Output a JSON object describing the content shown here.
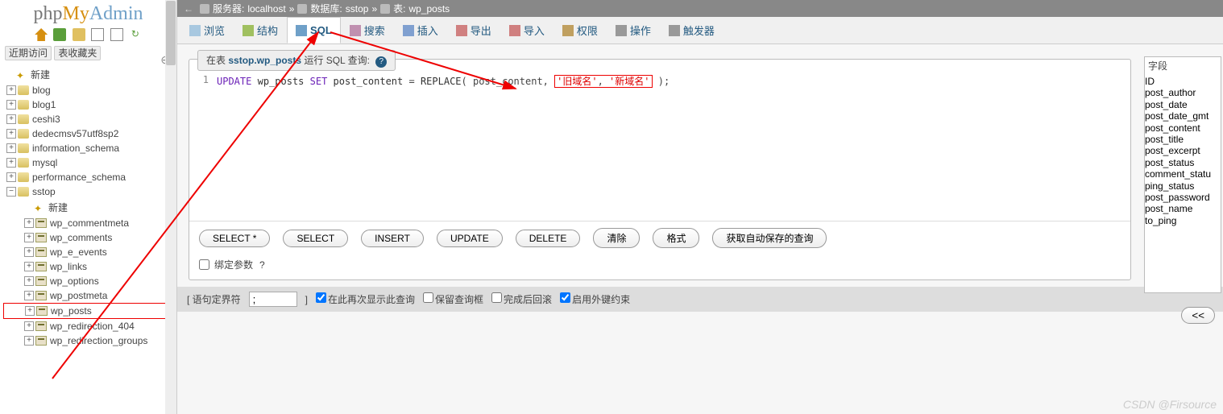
{
  "logo": {
    "part1": "php",
    "part2": "My",
    "part3": "Admin"
  },
  "sidebar_tabs": {
    "recent": "近期访问",
    "fav": "表收藏夹"
  },
  "tree": {
    "new": "新建",
    "dbs": [
      "blog",
      "blog1",
      "ceshi3",
      "dedecmsv57utf8sp2",
      "information_schema",
      "mysql",
      "performance_schema"
    ],
    "active_db": "sstop",
    "tables": [
      "wp_commentmeta",
      "wp_comments",
      "wp_e_events",
      "wp_links",
      "wp_options",
      "wp_postmeta",
      "wp_posts",
      "wp_redirection_404",
      "wp_redirection_groups"
    ]
  },
  "breadcrumb": {
    "server_lbl": "服务器:",
    "server": "localhost",
    "db_lbl": "数据库:",
    "db": "sstop",
    "tbl_lbl": "表:",
    "tbl": "wp_posts",
    "sep": "»"
  },
  "tabs": {
    "browse": "浏览",
    "structure": "结构",
    "sql": "SQL",
    "search": "搜索",
    "insert": "插入",
    "export": "导出",
    "import": "导入",
    "priv": "权限",
    "ops": "操作",
    "trig": "触发器"
  },
  "panel": {
    "prefix": "在表 ",
    "target": "sstop.wp_posts",
    "suffix": " 运行 SQL 查询:",
    "sql_line": "1",
    "sql": {
      "update": "UPDATE",
      "tbl": "wp_posts",
      "set": "SET",
      "col": "post_content",
      "eq": "=",
      "repl": "REPLACE",
      "open": "( post_content,",
      "old": "'旧域名'",
      "comma": ", ",
      "new": "'新域名'",
      "close": ");"
    }
  },
  "buttons": {
    "selstar": "SELECT *",
    "select": "SELECT",
    "insert": "INSERT",
    "update": "UPDATE",
    "delete": "DELETE",
    "clear": "清除",
    "format": "格式",
    "autosave": "获取自动保存的查询",
    "bind": "绑定参数",
    "arrows": "<<"
  },
  "fields": {
    "title": "字段",
    "cols": [
      "ID",
      "post_author",
      "post_date",
      "post_date_gmt",
      "post_content",
      "post_title",
      "post_excerpt",
      "post_status",
      "comment_statu",
      "ping_status",
      "post_password",
      "post_name",
      "to_ping"
    ]
  },
  "footer": {
    "delim_lbl": "[ 语句定界符",
    "delim_val": ";",
    "delim_close": "]",
    "again": "在此再次显示此查询",
    "keep": "保留查询框",
    "rollback": "完成后回滚",
    "fk": "启用外键约束"
  },
  "watermark": "CSDN @Firsource"
}
